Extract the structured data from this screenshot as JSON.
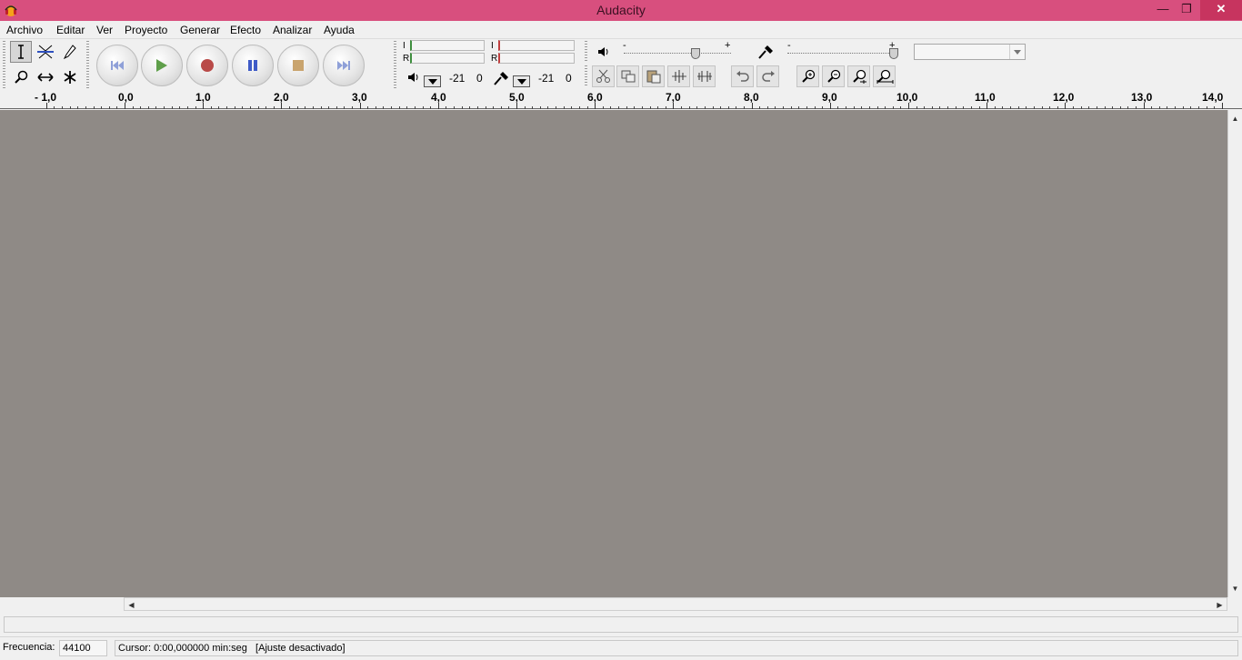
{
  "window": {
    "title": "Audacity",
    "minimize_glyph": "—",
    "maximize_glyph": "❐",
    "close_glyph": "✕"
  },
  "menu": {
    "items": [
      "Archivo",
      "Editar",
      "Ver",
      "Proyecto",
      "Generar",
      "Efecto",
      "Analizar",
      "Ayuda"
    ]
  },
  "meters": {
    "playback": {
      "left_label": "I",
      "right_label": "R",
      "db_value": "-21",
      "zero_value": "0"
    },
    "record": {
      "left_label": "I",
      "right_label": "R",
      "db_value": "-21",
      "zero_value": "0"
    }
  },
  "mixer": {
    "output_minus": "-",
    "output_plus": "+",
    "input_minus": "-",
    "input_plus": "+"
  },
  "ruler": {
    "labels": [
      "- 1,0",
      "0,0",
      "1,0",
      "2,0",
      "3,0",
      "4,0",
      "5,0",
      "6,0",
      "7,0",
      "8,0",
      "9,0",
      "10,0",
      "11,0",
      "12,0",
      "13,0",
      "14,0"
    ]
  },
  "status": {
    "rate_label": "Frecuencia:",
    "rate_value": "44100",
    "cursor_text": "Cursor: 0:00,000000 min:seg",
    "snap_text": "[Ajuste desactivado]"
  },
  "colors": {
    "titlebar": "#d84f7e",
    "track_background": "#8f8a86",
    "record_red": "#b94a48",
    "pause_blue": "#3f5bc7",
    "play_green": "#5f9f4a",
    "stop_tan": "#c9a46e"
  },
  "icons": {
    "tools": [
      "selection-tool-icon",
      "envelope-tool-icon",
      "draw-tool-icon",
      "zoom-tool-icon",
      "timeshift-tool-icon",
      "multi-tool-icon"
    ],
    "transport": [
      "skip-to-start-icon",
      "play-icon",
      "record-icon",
      "pause-icon",
      "stop-icon",
      "skip-to-end-icon"
    ],
    "edit": [
      "cut-icon",
      "copy-icon",
      "paste-icon",
      "trim-icon",
      "silence-icon",
      "undo-icon",
      "redo-icon",
      "zoom-in-icon",
      "zoom-out-icon",
      "fit-selection-icon",
      "fit-project-icon"
    ]
  }
}
